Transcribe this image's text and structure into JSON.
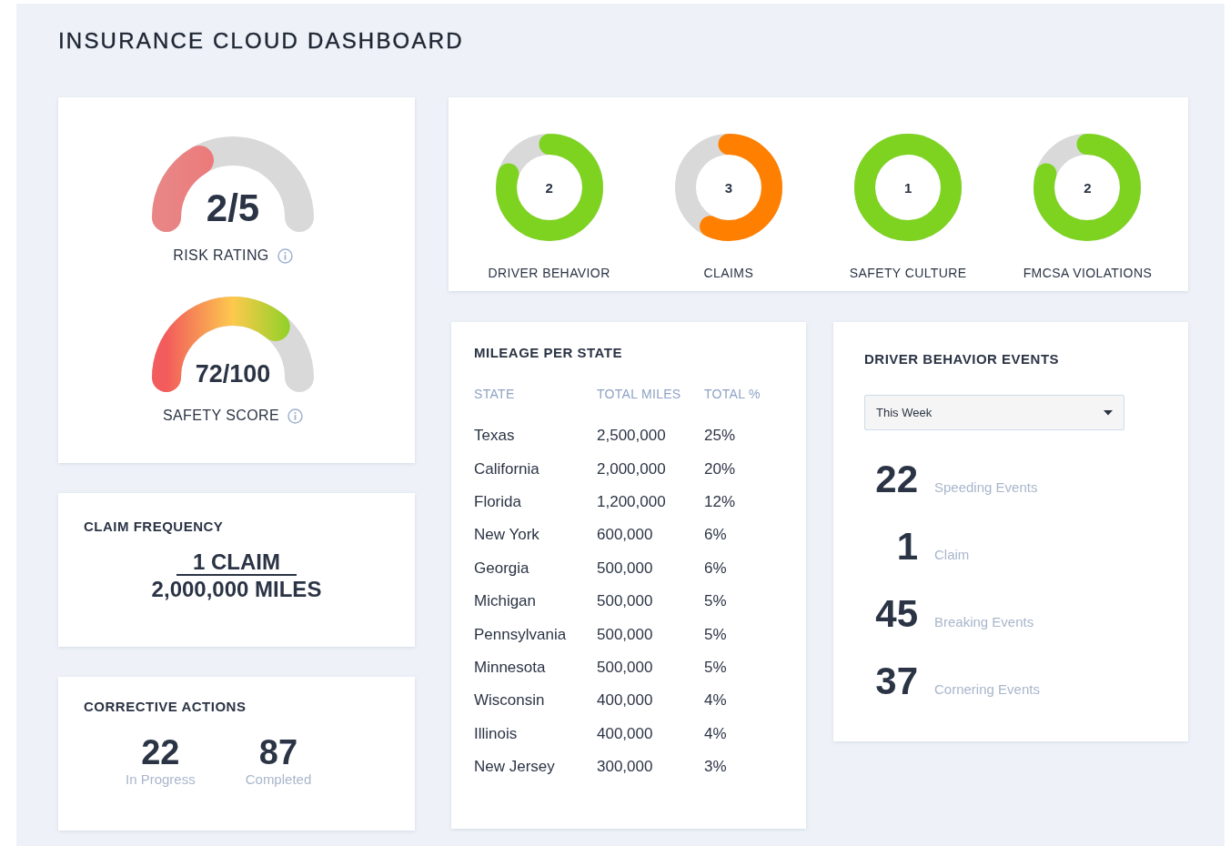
{
  "title": "INSURANCE CLOUD DASHBOARD",
  "gauges": [
    {
      "kind": "solid",
      "value": "2/5",
      "label": "RISK RATING"
    },
    {
      "kind": "gradient",
      "value": "72/100",
      "label": "SAFETY SCORE"
    }
  ],
  "scores": [
    {
      "value": "2",
      "label": "DRIVER BEHAVIOR",
      "level": 0.8,
      "color": "#7ed321"
    },
    {
      "value": "3",
      "label": "CLAIMS",
      "level": 0.57,
      "color": "#ff8000"
    },
    {
      "value": "1",
      "label": "SAFETY CULTURE",
      "level": 1,
      "color": "#7ed321"
    },
    {
      "value": "2",
      "label": "FMCSA VIOLATIONS",
      "level": 0.8,
      "color": "#7ed321"
    }
  ],
  "claim_frequency": {
    "title": "CLAIM FREQUENCY",
    "numerator": "1 CLAIM",
    "denominator": "2,000,000 MILES"
  },
  "corrective_actions": {
    "title": "CORRECTIVE ACTIONS",
    "stats": [
      {
        "value": "22",
        "label": "In Progress"
      },
      {
        "value": "87",
        "label": "Completed"
      }
    ]
  },
  "mileage": {
    "title": "MILEAGE PER STATE",
    "columns": [
      "STATE",
      "TOTAL MILES",
      "TOTAL %"
    ],
    "rows": [
      [
        "Texas",
        "2,500,000",
        "25%"
      ],
      [
        "California",
        "2,000,000",
        "20%"
      ],
      [
        "Florida",
        "1,200,000",
        "12%"
      ],
      [
        "New York",
        "600,000",
        "6%"
      ],
      [
        "Georgia",
        "500,000",
        "6%"
      ],
      [
        "Michigan",
        "500,000",
        "5%"
      ],
      [
        "Pennsylvania",
        "500,000",
        "5%"
      ],
      [
        "Minnesota",
        "500,000",
        "5%"
      ],
      [
        "Wisconsin",
        "400,000",
        "4%"
      ],
      [
        "Illinois",
        "400,000",
        "4%"
      ],
      [
        "New Jersey",
        "300,000",
        "3%"
      ]
    ]
  },
  "driver_events": {
    "title": "DRIVER BEHAVIOR EVENTS",
    "period": {
      "value": "This Week"
    },
    "events": [
      {
        "value": "22",
        "label": "Speeding Events"
      },
      {
        "value": "1",
        "label": "Claim"
      },
      {
        "value": "45",
        "label": "Breaking Events"
      },
      {
        "value": "37",
        "label": "Cornering Events"
      }
    ]
  }
}
